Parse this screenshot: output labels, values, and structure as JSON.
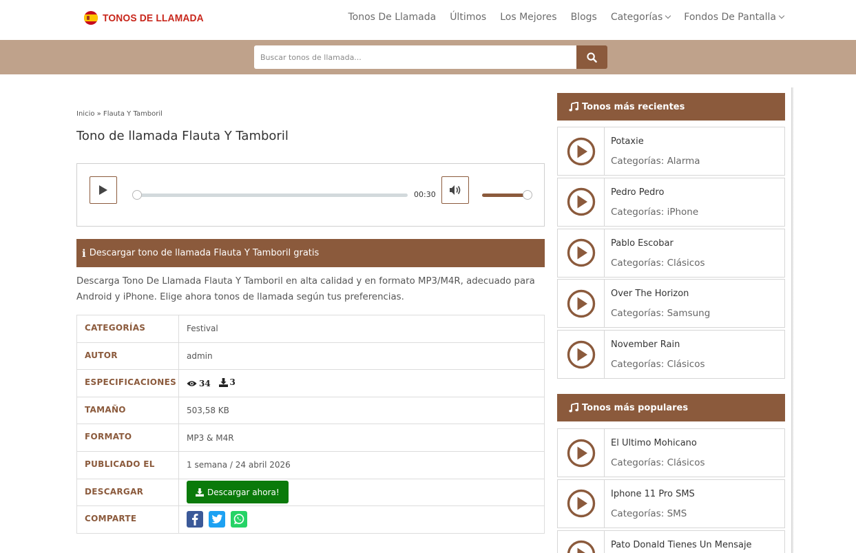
{
  "site": {
    "logo_text": "TONOS DE LLAMADA"
  },
  "nav": {
    "items": [
      "Tonos De Llamada",
      "Últimos",
      "Los Mejores",
      "Blogs",
      "Categorías",
      "Fondos De Pantalla"
    ]
  },
  "search": {
    "placeholder": "Buscar tonos de llamada..."
  },
  "breadcrumb": "Inicio » Flauta Y Tamboril",
  "page_title": "Tono de llamada Flauta Y Tamboril",
  "player": {
    "duration": "00:30",
    "progress": 0,
    "volume": 1.0
  },
  "download_section": {
    "title": "Descargar tono de llamada Flauta Y Tamboril gratis",
    "description": "Descarga Tono De Llamada Flauta Y Tamboril en alta calidad y en formato MP3/M4R, adecuado para Android y iPhone. Elige ahora tonos de llamada según tus preferencias."
  },
  "details": {
    "categorias_label": "CATEGORÍAS",
    "categorias_value": "Festival",
    "autor_label": "AUTOR",
    "autor_value": "admin",
    "especificaciones_label": "ESPECIFICACIONES",
    "views": "34",
    "downloads": "3",
    "tamano_label": "TAMAÑO",
    "tamano_value": "503,58 KB",
    "formato_label": "FORMATO",
    "formato_value": "MP3 & M4R",
    "publicado_label": "PUBLICADO EL",
    "publicado_value": "1 semana / 24 abril 2026",
    "descargar_label": "DESCARGAR",
    "descargar_button": "Descargar ahora!",
    "comparte_label": "COMPARTE"
  },
  "colors": {
    "brand": "#8b5a3c",
    "search_band": "#bfa28b",
    "download_green": "#0a7a0a",
    "facebook": "#3b5998",
    "twitter": "#1da1f2",
    "whatsapp": "#25d366"
  },
  "sidebar": {
    "recent_title": "Tonos más recientes",
    "recent": [
      {
        "name": "Potaxie",
        "category": "Categorías: Alarma"
      },
      {
        "name": "Pedro Pedro",
        "category": "Categorías: iPhone"
      },
      {
        "name": "Pablo Escobar",
        "category": "Categorías: Clásicos"
      },
      {
        "name": "Over The Horizon",
        "category": "Categorías: Samsung"
      },
      {
        "name": "November Rain",
        "category": "Categorías: Clásicos"
      }
    ],
    "popular_title": "Tonos más populares",
    "popular": [
      {
        "name": "El Ultimo Mohicano",
        "category": "Categorías: Clásicos"
      },
      {
        "name": "Iphone 11 Pro SMS",
        "category": "Categorías: SMS"
      },
      {
        "name": "Pato Donald Tienes Un Mensaje",
        "category": ""
      }
    ]
  }
}
